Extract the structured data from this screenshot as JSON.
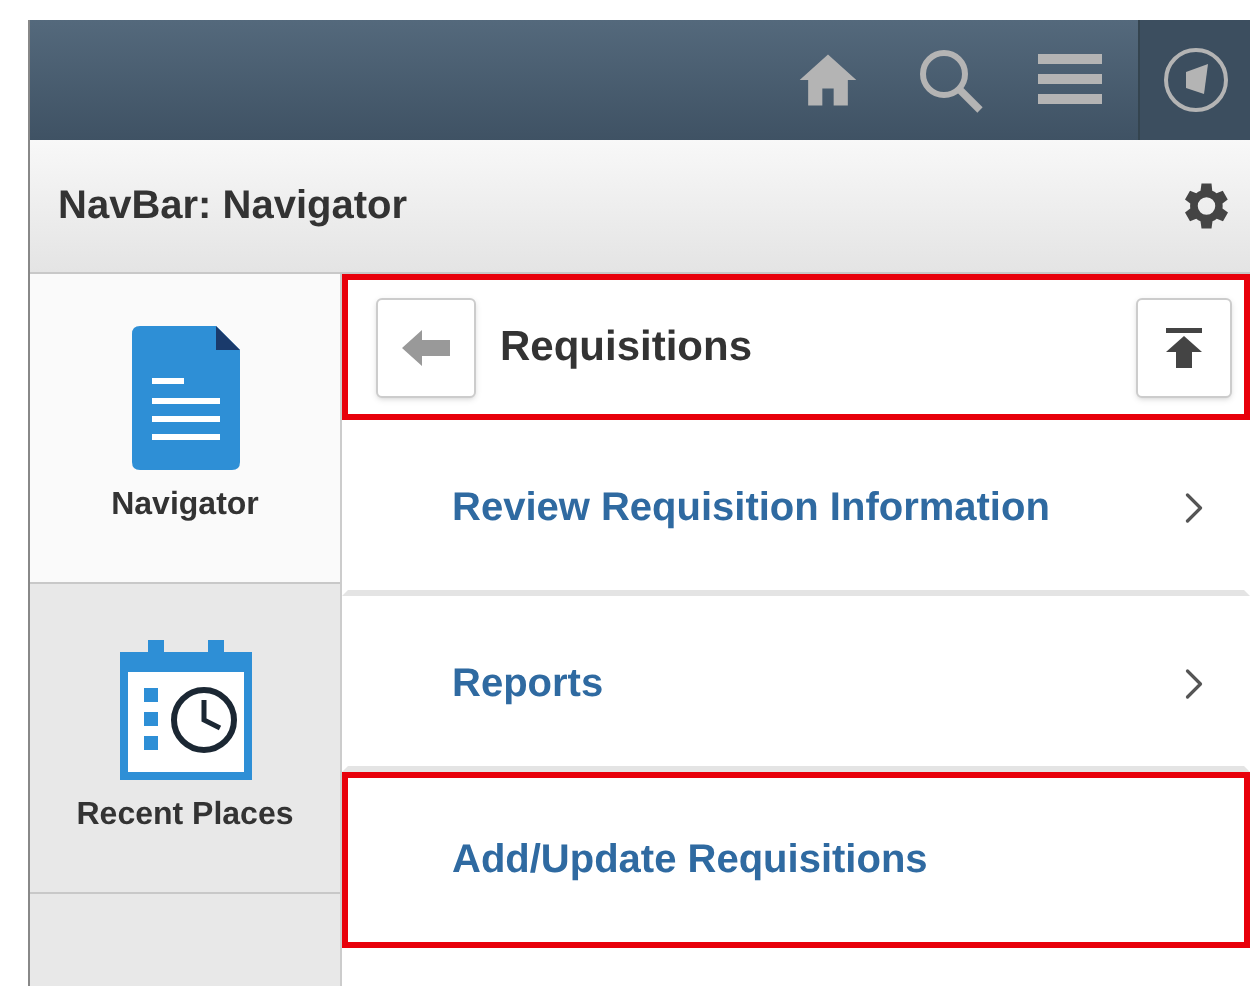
{
  "panel": {
    "title": "NavBar: Navigator"
  },
  "sidebar": {
    "items": [
      {
        "label": "Navigator",
        "kind": "document",
        "selected": true
      },
      {
        "label": "Recent Places",
        "kind": "calendar",
        "selected": false
      }
    ]
  },
  "folder": {
    "title": "Requisitions",
    "highlighted": true
  },
  "items": [
    {
      "label": "Review Requisition Information",
      "has_children": true,
      "highlighted": false
    },
    {
      "label": "Reports",
      "has_children": true,
      "highlighted": false
    },
    {
      "label": "Add/Update Requisitions",
      "has_children": false,
      "highlighted": true
    }
  ]
}
